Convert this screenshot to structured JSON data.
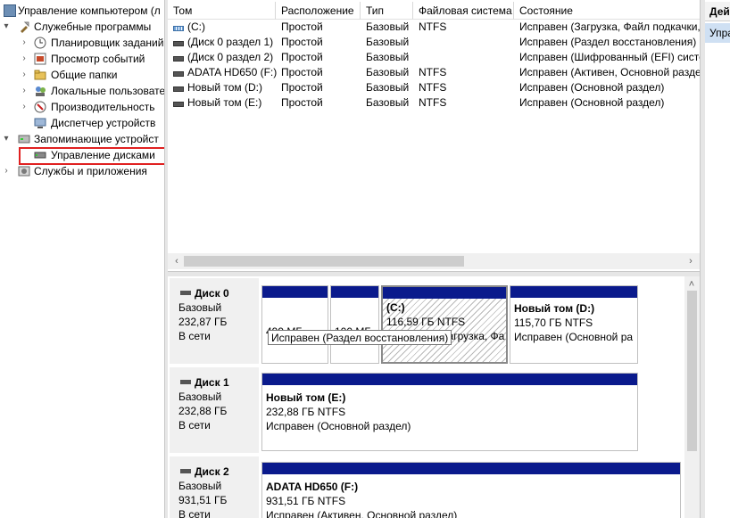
{
  "tree": {
    "items": [
      {
        "label": "Управление компьютером (л",
        "icon": "computer-management-icon",
        "arrow": "",
        "indent": 0
      },
      {
        "label": "Служебные программы",
        "icon": "tools-icon",
        "arrow": "▾",
        "indent": 1
      },
      {
        "label": "Планировщик заданий",
        "icon": "clock-icon",
        "arrow": "›",
        "indent": 2
      },
      {
        "label": "Просмотр событий",
        "icon": "event-viewer-icon",
        "arrow": "›",
        "indent": 2
      },
      {
        "label": "Общие папки",
        "icon": "shared-folder-icon",
        "arrow": "›",
        "indent": 2
      },
      {
        "label": "Локальные пользовате",
        "icon": "users-icon",
        "arrow": "›",
        "indent": 2
      },
      {
        "label": "Производительность",
        "icon": "performance-icon",
        "arrow": "›",
        "indent": 2
      },
      {
        "label": "Диспетчер устройств",
        "icon": "device-manager-icon",
        "arrow": "",
        "indent": 2
      },
      {
        "label": "Запоминающие устройст",
        "icon": "storage-icon",
        "arrow": "▾",
        "indent": 1
      },
      {
        "label": "Управление дисками",
        "icon": "disk-management-icon",
        "arrow": "",
        "indent": 2
      },
      {
        "label": "Службы и приложения",
        "icon": "services-icon",
        "arrow": "›",
        "indent": 1
      }
    ]
  },
  "volumes": {
    "columns": [
      "Том",
      "Расположение",
      "Тип",
      "Файловая система",
      "Состояние"
    ],
    "rows": [
      {
        "name": "(C:)",
        "layout": "Простой",
        "type": "Базовый",
        "fs": "NTFS",
        "status": "Исправен (Загрузка, Файл подкачки, Ав"
      },
      {
        "name": "(Диск 0 раздел 1)",
        "layout": "Простой",
        "type": "Базовый",
        "fs": "",
        "status": "Исправен (Раздел восстановления)"
      },
      {
        "name": "(Диск 0 раздел 2)",
        "layout": "Простой",
        "type": "Базовый",
        "fs": "",
        "status": "Исправен (Шифрованный (EFI) систе"
      },
      {
        "name": "ADATA HD650 (F:)",
        "layout": "Простой",
        "type": "Базовый",
        "fs": "NTFS",
        "status": "Исправен (Активен, Основной разде"
      },
      {
        "name": "Новый том (D:)",
        "layout": "Простой",
        "type": "Базовый",
        "fs": "NTFS",
        "status": "Исправен (Основной раздел)"
      },
      {
        "name": "Новый том (E:)",
        "layout": "Простой",
        "type": "Базовый",
        "fs": "NTFS",
        "status": "Исправен (Основной раздел)"
      }
    ]
  },
  "scroll": {
    "left": "‹",
    "right": "›",
    "up": "˄"
  },
  "actions": {
    "header": "Дейс",
    "item": "Упра"
  },
  "disks": [
    {
      "name": "Диск 0",
      "type": "Базовый",
      "size": "232,87 ГБ",
      "status": "В сети",
      "partitions": [
        {
          "title": "",
          "size": "499 МБ",
          "status": ""
        },
        {
          "title": "",
          "size": "100 МБ",
          "status": ""
        },
        {
          "title": "(C:)",
          "size": "116,59 ГБ NTFS",
          "status": "Исправен (Загрузка, Фа"
        },
        {
          "title": "Новый том  (D:)",
          "size": "115,70 ГБ NTFS",
          "status": "Исправен (Основной ра"
        }
      ]
    },
    {
      "name": "Диск 1",
      "type": "Базовый",
      "size": "232,88 ГБ",
      "status": "В сети",
      "partitions": [
        {
          "title": "Новый том  (E:)",
          "size": "232,88 ГБ NTFS",
          "status": "Исправен (Основной раздел)"
        }
      ]
    },
    {
      "name": "Диск 2",
      "type": "Базовый",
      "size": "931,51 ГБ",
      "status": "В сети",
      "partitions": [
        {
          "title": "ADATA HD650  (F:)",
          "size": "931,51 ГБ NTFS",
          "status": "Исправен (Активен, Основной раздел)"
        }
      ]
    }
  ],
  "tooltip": "Исправен (Раздел восстановления)",
  "colors": {
    "partition_bar": "#0a1a8c",
    "highlight": "#e02020",
    "selection": "#cfe0f3"
  }
}
